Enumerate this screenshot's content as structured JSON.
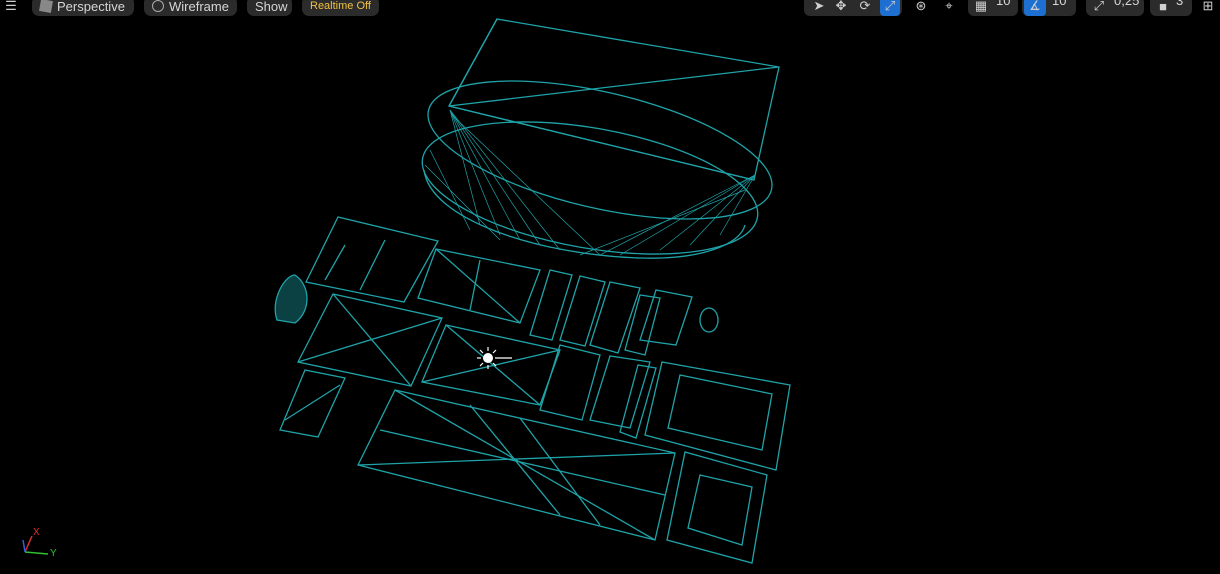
{
  "toolbar": {
    "menu_icon": "hamburger-icon",
    "perspective_label": "Perspective",
    "wireframe_label": "Wireframe",
    "show_label": "Show",
    "realtime_label": "Realtime Off",
    "grid_snap_value": "10",
    "rotation_snap_value": "10°",
    "scale_snap_value": "0,25",
    "camera_speed_value": "3",
    "transform_tools": [
      "select-icon",
      "move-icon",
      "rotate-icon",
      "scale-icon"
    ],
    "active_tool": "scale-icon",
    "colors": {
      "accent_label": "#f0c040",
      "selected": "#1d6fd1",
      "wire": "#1fa3a8"
    }
  },
  "axis": {
    "x_label": "X",
    "y_label": "Y"
  }
}
